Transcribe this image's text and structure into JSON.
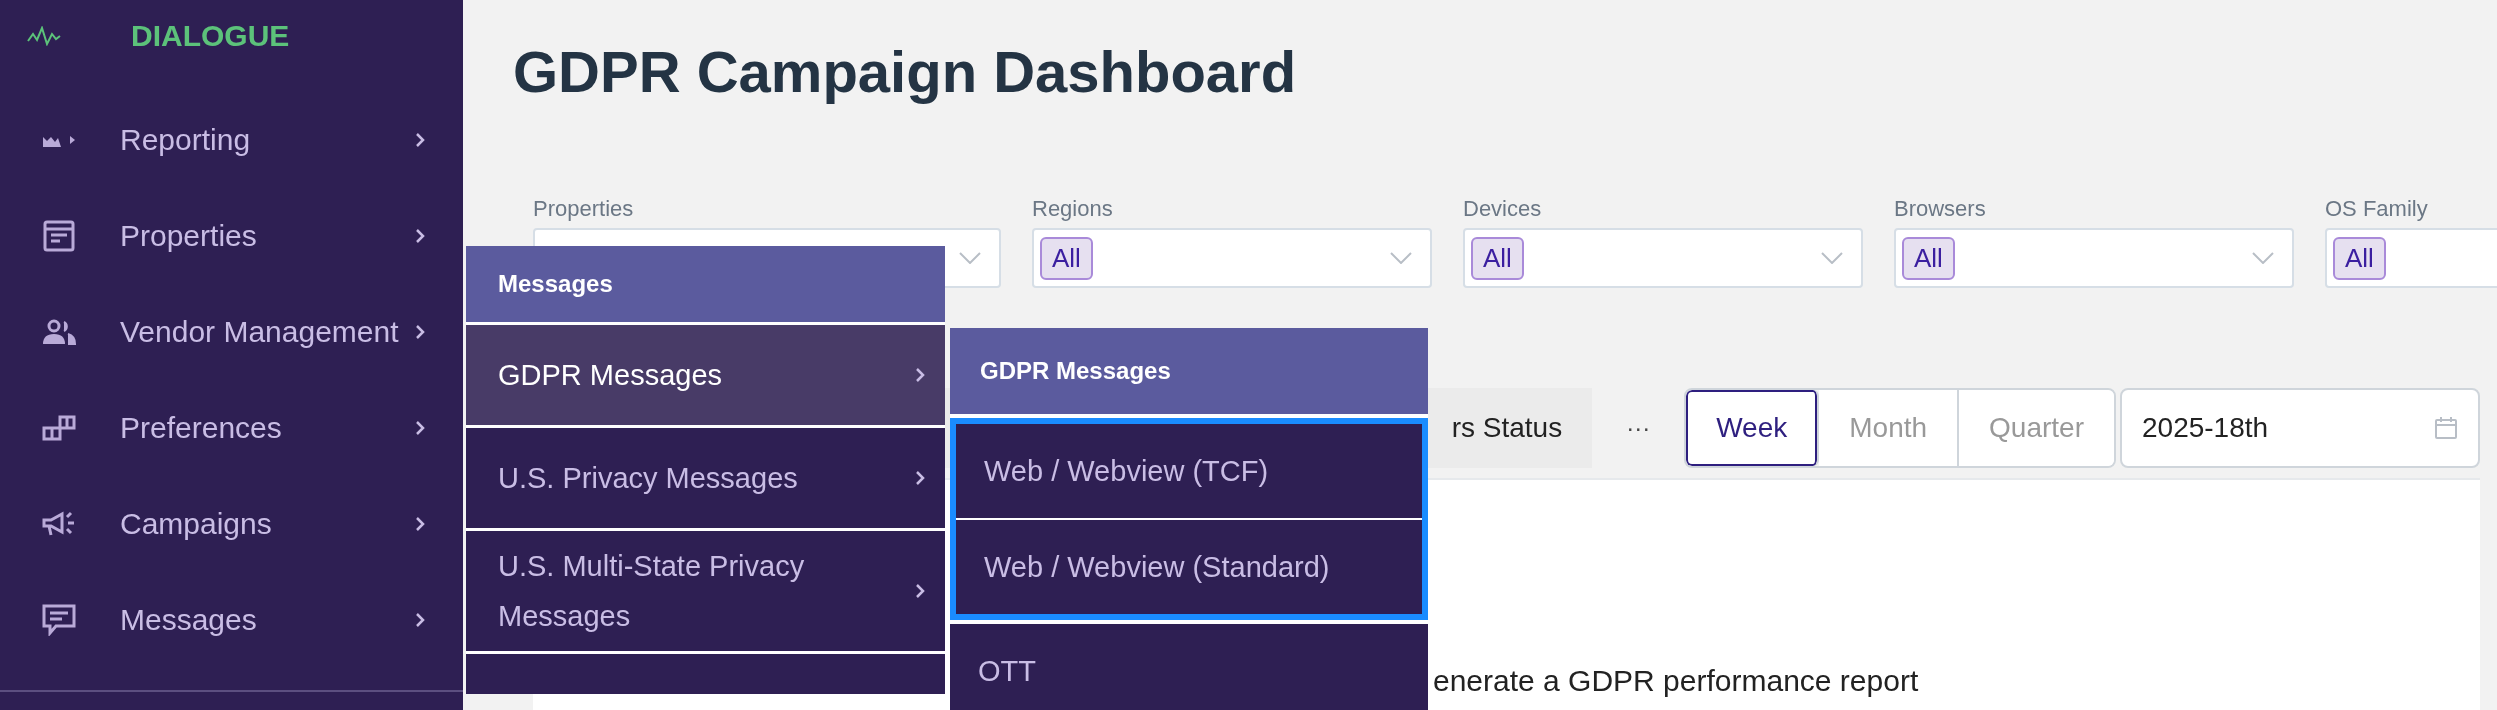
{
  "sidebar": {
    "brand": "DIALOGUE",
    "items": [
      {
        "label": "Reporting",
        "submenu": true
      },
      {
        "label": "Properties",
        "submenu": true
      },
      {
        "label": "Vendor Management",
        "submenu": true
      },
      {
        "label": "Preferences",
        "submenu": true
      },
      {
        "label": "Campaigns",
        "submenu": true
      },
      {
        "label": "Messages",
        "submenu": true
      }
    ]
  },
  "page": {
    "title": "GDPR Campaign Dashboard"
  },
  "filters": [
    {
      "label": "Properties"
    },
    {
      "label": "Regions",
      "chip": "All"
    },
    {
      "label": "Devices",
      "chip": "All"
    },
    {
      "label": "Browsers",
      "chip": "All"
    },
    {
      "label": "OS Family",
      "chip": "All"
    }
  ],
  "toolbar": {
    "tab": "rs Status",
    "more": "···",
    "periods": [
      {
        "label": "Week",
        "selected": true
      },
      {
        "label": "Month",
        "selected": false
      },
      {
        "label": "Quarter",
        "selected": false
      }
    ],
    "date": "2025-18th"
  },
  "panel": {
    "text": "enerate a GDPR performance report"
  },
  "messages_menu": {
    "title": "Messages",
    "items": [
      {
        "label": "GDPR Messages",
        "selected": true,
        "submenu": true
      },
      {
        "label": "U.S. Privacy Messages",
        "selected": false,
        "submenu": true
      },
      {
        "label": "U.S. Multi-State Privacy Messages",
        "selected": false,
        "submenu": true
      }
    ]
  },
  "gdpr_menu": {
    "title": "GDPR Messages",
    "groups": [
      {
        "focused": true,
        "items": [
          "Web / Webview (TCF)",
          "Web / Webview (Standard)"
        ]
      },
      {
        "focused": false,
        "items": [
          "OTT"
        ]
      }
    ]
  }
}
